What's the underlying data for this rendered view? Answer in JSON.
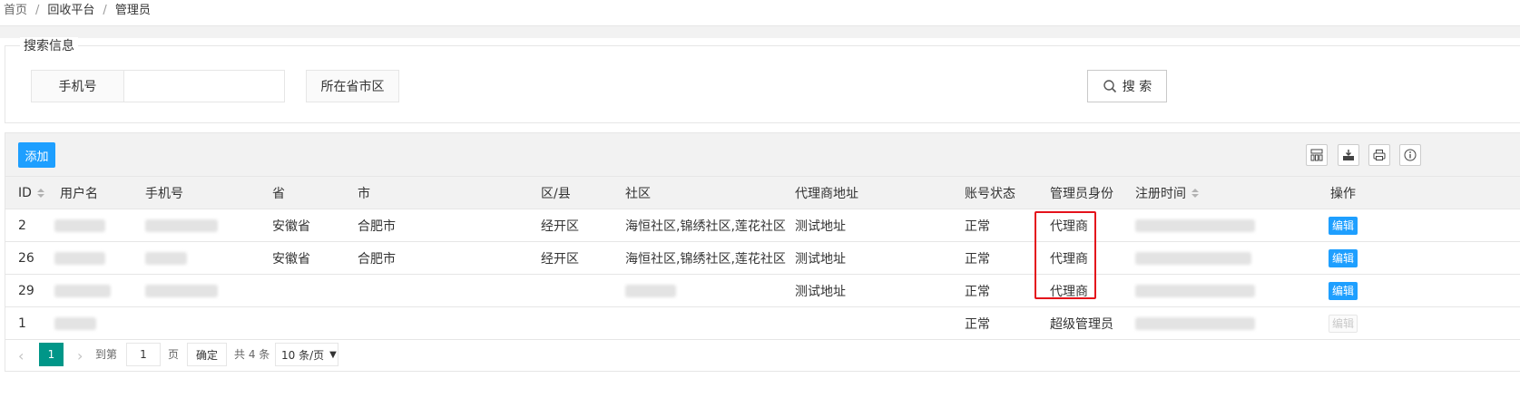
{
  "breadcrumb": {
    "items": [
      "首页",
      "回收平台",
      "管理员"
    ],
    "separator": "/"
  },
  "search": {
    "legend": "搜索信息",
    "phone_label": "手机号",
    "phone_value": "",
    "region_label": "所在省市区",
    "search_button": "搜 索"
  },
  "toolbar": {
    "add_label": "添加",
    "tools": [
      "columns-icon",
      "export-icon",
      "print-icon",
      "info-icon"
    ]
  },
  "table": {
    "columns": [
      "ID",
      "用户名",
      "手机号",
      "省",
      "市",
      "区/县",
      "社区",
      "代理商地址",
      "账号状态",
      "管理员身份",
      "注册时间",
      "操作"
    ],
    "sortable": [
      "ID",
      "注册时间"
    ],
    "rows": [
      {
        "id": "2",
        "province": "安徽省",
        "city": "合肥市",
        "district": "经开区",
        "community": "海恒社区,锦绣社区,莲花社区",
        "address": "测试地址",
        "status": "正常",
        "role": "代理商",
        "action": "编辑",
        "action_disabled": false
      },
      {
        "id": "26",
        "province": "安徽省",
        "city": "合肥市",
        "district": "经开区",
        "community": "海恒社区,锦绣社区,莲花社区",
        "address": "测试地址",
        "status": "正常",
        "role": "代理商",
        "action": "编辑",
        "action_disabled": false
      },
      {
        "id": "29",
        "province": "",
        "city": "",
        "district": "",
        "community": "",
        "address": "测试地址",
        "status": "正常",
        "role": "代理商",
        "action": "编辑",
        "action_disabled": false
      },
      {
        "id": "1",
        "province": "",
        "city": "",
        "district": "",
        "community": "",
        "address": "",
        "status": "正常",
        "role": "超级管理员",
        "action": "编辑",
        "action_disabled": true
      }
    ]
  },
  "pagination": {
    "current_page": "1",
    "goto_label": "到第",
    "goto_value": "1",
    "page_unit": "页",
    "confirm_label": "确定",
    "total_label": "共 4 条",
    "page_size": "10 条/页"
  },
  "colors": {
    "primary": "#1e9fff",
    "pager_active": "#009688",
    "highlight": "#e4121b"
  }
}
